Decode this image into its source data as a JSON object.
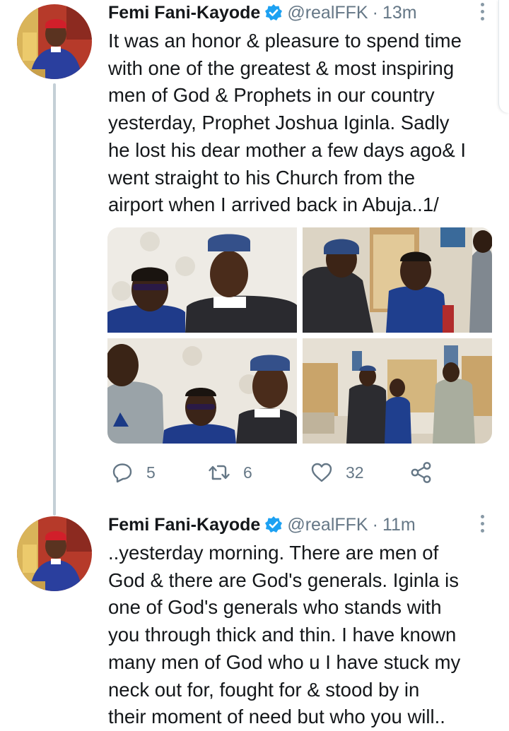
{
  "tweets": [
    {
      "author_name": "Femi Fani-Kayode",
      "handle": "@realFFK",
      "separator": "·",
      "time": "13m",
      "text": "It was an honor & pleasure to spend time\nwith one of the greatest & most inspiring\nmen of God & Prophets in our country\nyesterday, Prophet Joshua Iginla. Sadly\nhe lost his dear mother a few days ago& I\nwent straight to his Church from the\nairport when I arrived back in Abuja..1/",
      "replies": "5",
      "retweets": "6",
      "likes": "32"
    },
    {
      "author_name": "Femi Fani-Kayode",
      "handle": "@realFFK",
      "separator": "·",
      "time": "11m",
      "text": "..yesterday morning. There are men of\nGod & there are God's generals. Iginla is\none of God's generals who stands with\nyou through thick and thin. I have known\nmany men of God who u I have stuck my\nneck out for, fought for & stood by in\ntheir moment of need but who you will.."
    }
  ],
  "icons": {
    "verified": "verified-badge-icon",
    "more": "more-vertical-icon",
    "reply": "reply-icon",
    "retweet": "retweet-icon",
    "like": "heart-icon",
    "share": "share-icon"
  },
  "colors": {
    "accent": "#1da1f2",
    "muted": "#657786",
    "text": "#14171a",
    "thread_line": "#c4cfd6"
  }
}
